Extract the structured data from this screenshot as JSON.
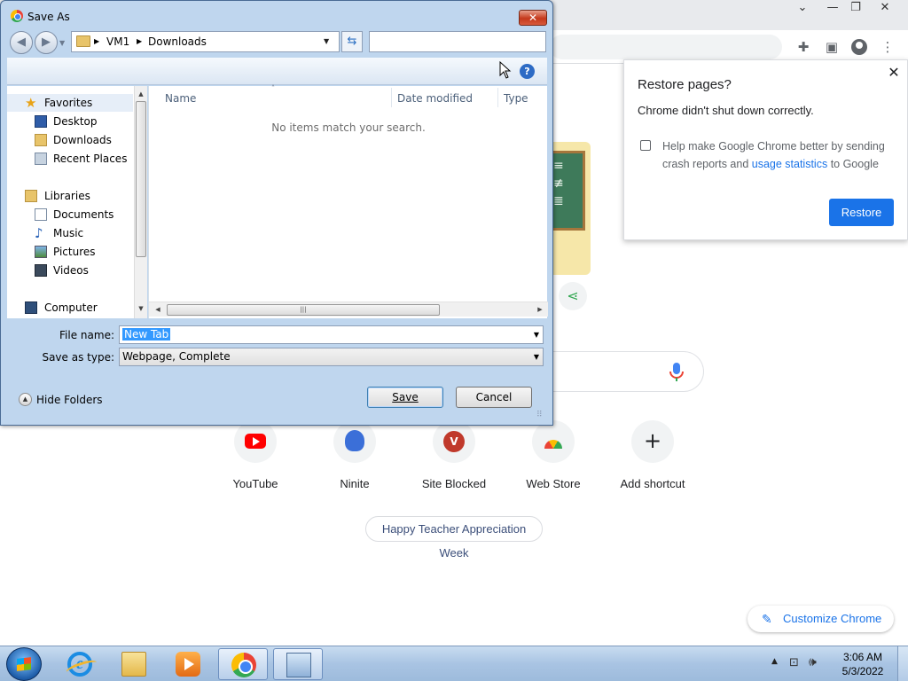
{
  "chrome": {
    "shortcuts": [
      {
        "label": "YouTube",
        "icon": "youtube-icon"
      },
      {
        "label": "Ninite",
        "icon": "ninite-icon"
      },
      {
        "label": "Site Blocked",
        "icon": "site-blocked-icon",
        "badge": "V"
      },
      {
        "label": "Web Store",
        "icon": "web-store-icon"
      },
      {
        "label": "Add shortcut",
        "icon": "plus-icon"
      }
    ],
    "doodle_chip": "Happy Teacher Appreciation Week",
    "customize_label": "Customize Chrome"
  },
  "restore_popup": {
    "title": "Restore pages?",
    "message": "Chrome didn't shut down correctly.",
    "checkbox_text_before": "Help make Google Chrome better by sending crash reports and ",
    "checkbox_link": "usage statistics",
    "checkbox_text_after": " to Google",
    "checkbox_checked": false,
    "restore_button": "Restore",
    "accent": "#1a73e8"
  },
  "dialog": {
    "title": "Save As",
    "breadcrumb": [
      "VM1",
      "Downloads"
    ],
    "search_placeholder": "",
    "nav_items": {
      "favorites": "Favorites",
      "desktop": "Desktop",
      "downloads": "Downloads",
      "recent": "Recent Places",
      "libraries": "Libraries",
      "documents": "Documents",
      "music": "Music",
      "pictures": "Pictures",
      "videos": "Videos",
      "computer": "Computer"
    },
    "columns": {
      "name": "Name",
      "date": "Date modified",
      "type": "Type"
    },
    "empty_message": "No items match your search.",
    "file_name_label": "File name:",
    "file_name_value": "New Tab",
    "save_type_label": "Save as type:",
    "save_type_value": "Webpage, Complete",
    "hide_folders": "Hide Folders",
    "save_button": "Save",
    "cancel_button": "Cancel"
  },
  "taskbar": {
    "time": "3:06 AM",
    "date": "5/3/2022",
    "apps": [
      "internet-explorer-icon",
      "windows-explorer-icon",
      "media-player-icon",
      "chrome-icon",
      "installer-icon"
    ]
  }
}
